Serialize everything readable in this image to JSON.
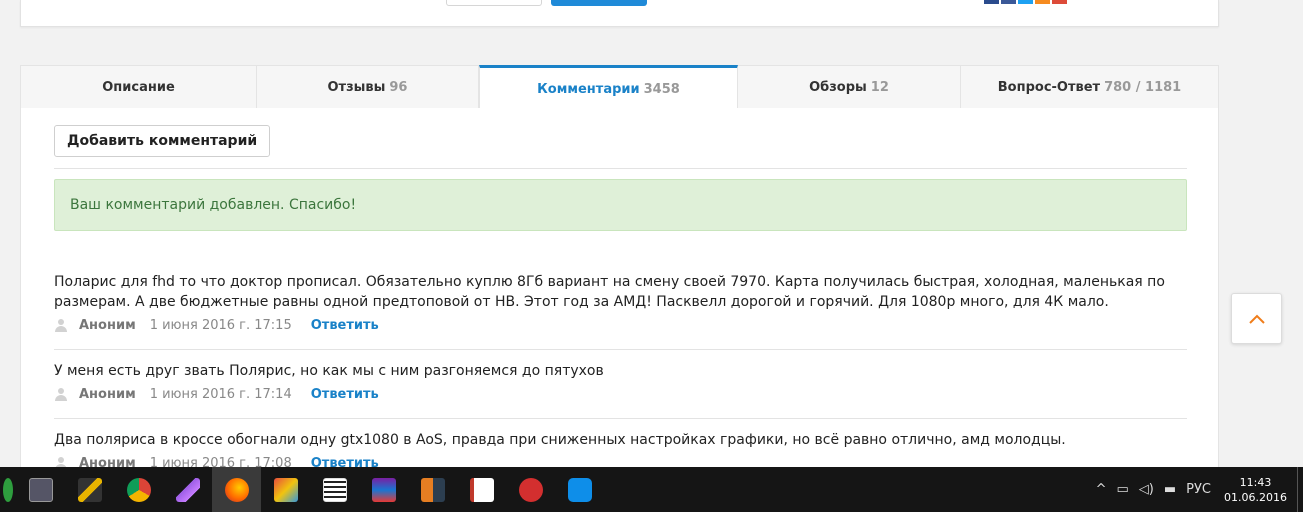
{
  "tabs": [
    {
      "label": "Описание",
      "count": ""
    },
    {
      "label": "Отзывы",
      "count": "96"
    },
    {
      "label": "Комментарии",
      "count": "3458"
    },
    {
      "label": "Обзоры",
      "count": "12"
    },
    {
      "label": "Вопрос-Ответ",
      "count": "780 / 1181"
    }
  ],
  "add_comment_label": "Добавить комментарий",
  "alert_text": "Ваш комментарий добавлен. Спасибо!",
  "comments": [
    {
      "text": "Поларис для fhd то что доктор прописал. Обязательно куплю 8Гб вариант на смену своей 7970. Карта получилась быстрая, холодная, маленькая по размерам. А две бюджетные равны одной предтоповой от НВ. Этот год за АМД! Пасквелл дорогой и горячий. Для 1080р много, для 4К мало.",
      "author": "Аноним",
      "date": "1 июня 2016 г. 17:15",
      "reply": "Ответить"
    },
    {
      "text": "У меня есть друг звать Полярис, но как мы с ним разгоняемся до пятухов",
      "author": "Аноним",
      "date": "1 июня 2016 г. 17:14",
      "reply": "Ответить"
    },
    {
      "text": "Два поляриса в кроссе обогнали одну gtx1080 в AoS, правда при сниженных настройках графики, но всё равно отлично, амд молодцы.",
      "author": "Аноним",
      "date": "1 июня 2016 г. 17:08",
      "reply": "Ответить"
    }
  ],
  "taskbar": {
    "apps": [
      "green-app-icon",
      "text-editor-icon",
      "tools-icon",
      "chrome-icon",
      "feather-icon",
      "firefox-icon",
      "paint-icon",
      "calculator-icon",
      "winrar-icon",
      "image-viewer-icon",
      "notes-icon",
      "chat-icon",
      "teamviewer-icon"
    ],
    "lang": "РУС",
    "time": "11:43",
    "date": "01.06.2016"
  },
  "colors": {
    "accent": "#1a82c8",
    "success_bg": "#dff0d8",
    "success_text": "#3c763d"
  }
}
